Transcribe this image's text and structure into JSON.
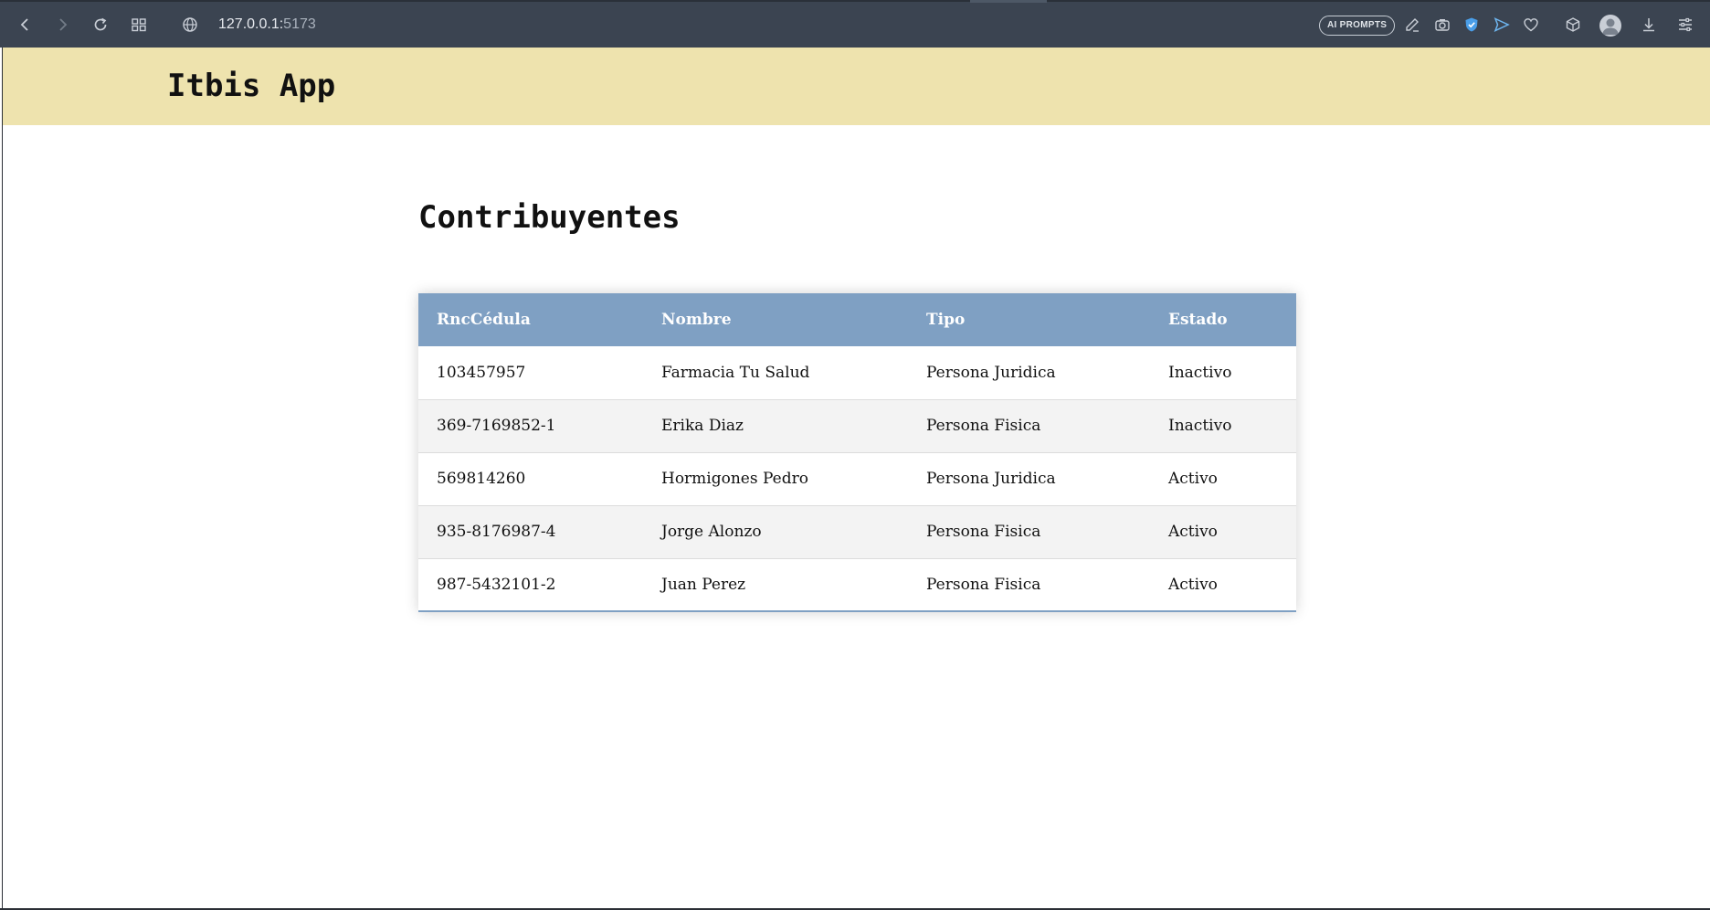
{
  "browser": {
    "url_host": "127.0.0.1:",
    "url_port": "5173",
    "ai_button_label": "AI PROMPTS",
    "icons": [
      "back-icon",
      "forward-icon",
      "reload-icon",
      "tab-grid-icon",
      "globe-icon",
      "edit-icon",
      "camera-icon",
      "shield-icon",
      "send-icon",
      "heart-icon",
      "box-icon",
      "avatar-icon",
      "download-icon",
      "settings-sliders-icon"
    ]
  },
  "app": {
    "title": "Itbis App",
    "header_color": "#eee3ae"
  },
  "main": {
    "title": "Contribuyentes",
    "table": {
      "header_color": "#7fa0c3",
      "columns": [
        "RncCédula",
        "Nombre",
        "Tipo",
        "Estado"
      ],
      "rows": [
        [
          "103457957",
          "Farmacia Tu Salud",
          "Persona Juridica",
          "Inactivo"
        ],
        [
          "369-7169852-1",
          "Erika Diaz",
          "Persona Fisica",
          "Inactivo"
        ],
        [
          "569814260",
          "Hormigones Pedro",
          "Persona Juridica",
          "Activo"
        ],
        [
          "935-8176987-4",
          "Jorge Alonzo",
          "Persona Fisica",
          "Activo"
        ],
        [
          "987-5432101-2",
          "Juan Perez",
          "Persona Fisica",
          "Activo"
        ]
      ]
    }
  }
}
